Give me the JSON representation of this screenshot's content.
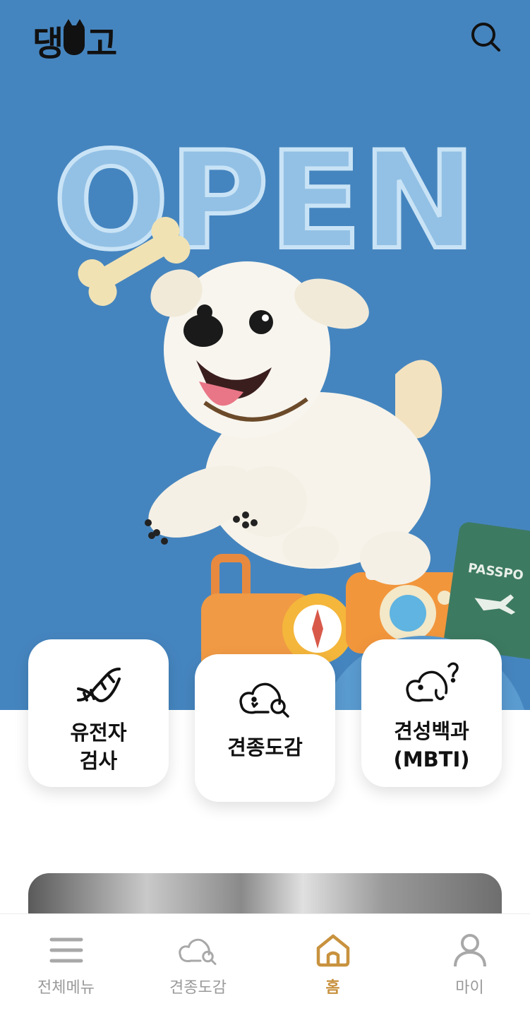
{
  "header": {
    "logo_text_left": "댕",
    "logo_text_right": "고",
    "search_icon": "search-icon"
  },
  "hero": {
    "banner_word": "OPEN",
    "passport_text": "PASSPO",
    "background_color": "#4585bf"
  },
  "menu_cards": [
    {
      "label": "유전자\n검사",
      "icon": "dna-icon"
    },
    {
      "label": "견종도감",
      "icon": "dog-search-icon"
    },
    {
      "label": "견성백과\n(MBTI)",
      "icon": "dog-question-icon"
    }
  ],
  "tabbar": {
    "items": [
      {
        "label": "전체메뉴",
        "icon": "hamburger-icon"
      },
      {
        "label": "견종도감",
        "icon": "dog-search-icon"
      },
      {
        "label": "홈",
        "icon": "home-icon"
      },
      {
        "label": "마이",
        "icon": "person-icon"
      }
    ],
    "active_index": 2,
    "active_color": "#c8923e",
    "inactive_color": "#9a9a9a"
  }
}
